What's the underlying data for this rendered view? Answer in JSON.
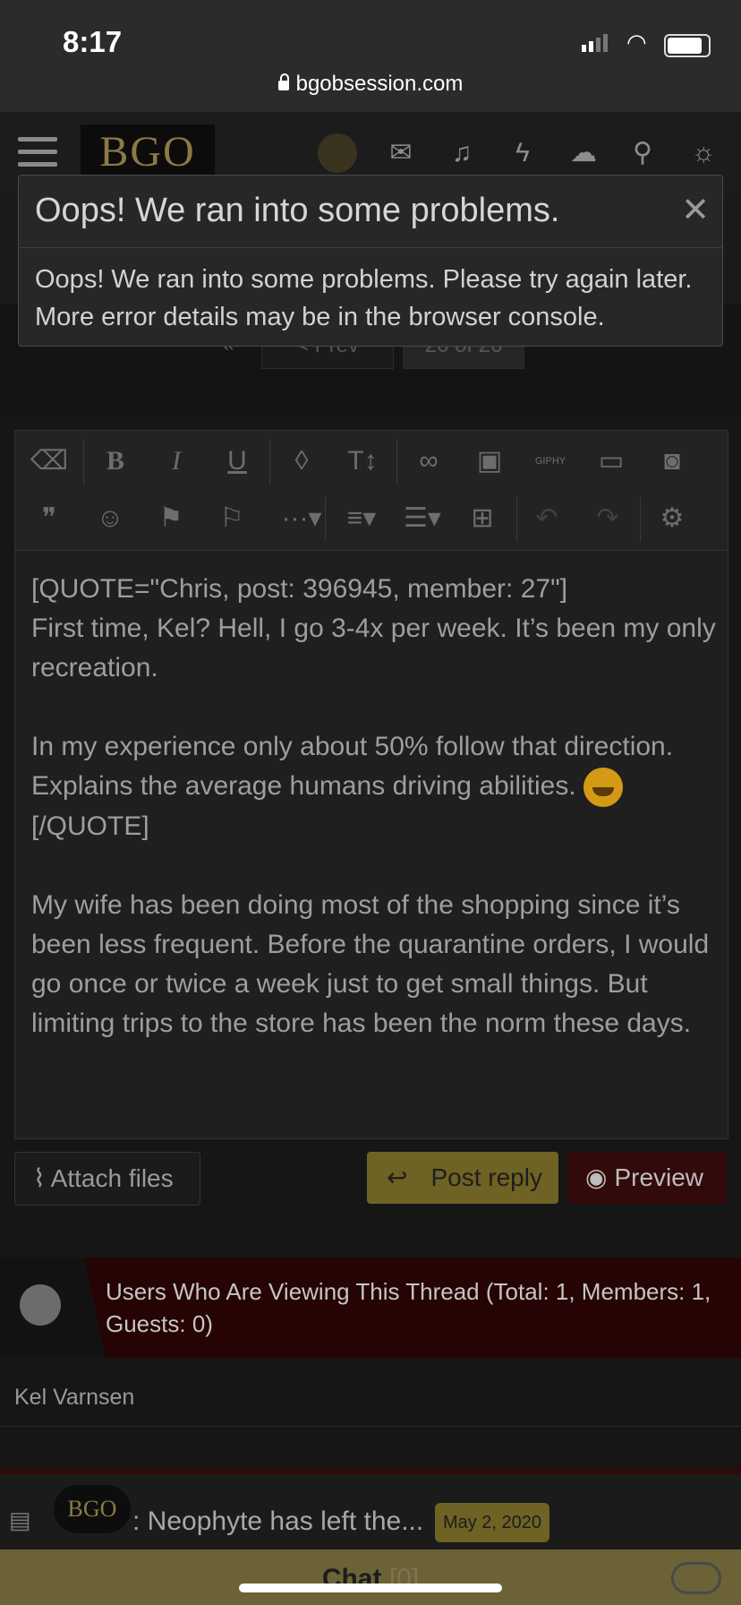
{
  "status": {
    "time": "8:17",
    "url": "bgobsession.com"
  },
  "nav": {
    "logo": "BGO"
  },
  "pager": {
    "prev": "< Prev",
    "page": "26 of 26"
  },
  "error": {
    "title": "Oops! We ran into some problems.",
    "close": "✕",
    "message": "Oops! We ran into some problems. Please try again later. More error details may be in the browser console."
  },
  "toolbar": {
    "row1": [
      "eraser-icon",
      "bold-icon",
      "italic-icon",
      "underline-icon",
      "color-icon",
      "text-size-icon",
      "link-icon",
      "image-icon",
      "giphy-icon",
      "video-icon",
      "camera-icon"
    ],
    "row2": [
      "quote-icon",
      "smilie-icon",
      "flag-icon",
      "checkered-flag-icon",
      "more-icon",
      "align-icon",
      "list-icon",
      "table-icon",
      "undo-icon",
      "redo-icon",
      "settings-icon"
    ],
    "giphy_label": "GIPHY"
  },
  "editor": {
    "p1": "[QUOTE=\"Chris, post: 396945, member: 27\"]\nFirst time, Kel? Hell, I go 3-4x per week. It’s been my only recreation.\n\nIn my experience only about 50% follow that direction. Explains the average humans driving abilities. ",
    "p2": "[/QUOTE]\n\nMy wife has been doing most of the shopping since it’s been less frequent. Before the quarantine orders, I would go once or twice a week just to get small things. But limiting trips to the store has been the norm these days."
  },
  "buttons": {
    "attach": "Attach files",
    "post_reply": "Post reply",
    "preview": "Preview"
  },
  "viewers": {
    "text": "Users Who Are Viewing This Thread (Total: 1, Members: 1, Guests: 0)",
    "member": "Kel Varnsen"
  },
  "chat": {
    "logo": "BGO",
    "message": ": Neophyte has left the...",
    "date": "May 2, 2020",
    "label": "Chat",
    "count": "[0]"
  },
  "colors": {
    "accent_gold": "#6e6224",
    "dark_red": "#260404",
    "preview_red": "#330a0a"
  }
}
